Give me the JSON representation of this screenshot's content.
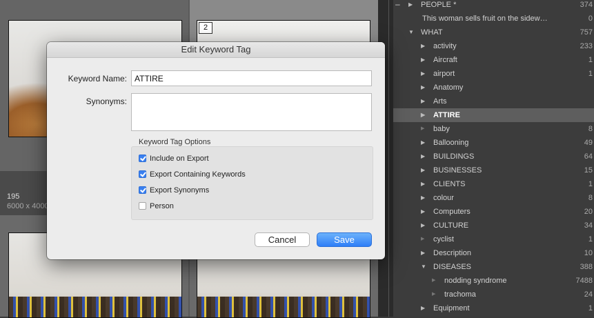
{
  "grid": {
    "badge_number": "2",
    "info_number": "195",
    "info_dimensions": "6000 x 4000"
  },
  "keyword_list": [
    {
      "label": "PEOPLE *",
      "count": "374",
      "level": 0,
      "expander": "right",
      "collapse_dash": true
    },
    {
      "label": "This woman sells fruit on the sidew…",
      "count": "0",
      "level": 0,
      "expander": "none"
    },
    {
      "label": "WHAT",
      "count": "757",
      "level": 0,
      "expander": "down"
    },
    {
      "label": "activity",
      "count": "233",
      "level": 1,
      "expander": "right"
    },
    {
      "label": "Aircraft",
      "count": "1",
      "level": 1,
      "expander": "right"
    },
    {
      "label": "airport",
      "count": "1",
      "level": 1,
      "expander": "right"
    },
    {
      "label": "Anatomy",
      "count": "",
      "level": 1,
      "expander": "right"
    },
    {
      "label": "Arts",
      "count": "",
      "level": 1,
      "expander": "right"
    },
    {
      "label": "ATTIRE",
      "count": "",
      "level": 1,
      "expander": "right",
      "selected": true
    },
    {
      "label": "baby",
      "count": "8",
      "level": 1,
      "expander": "leaf"
    },
    {
      "label": "Ballooning",
      "count": "49",
      "level": 1,
      "expander": "right"
    },
    {
      "label": "BUILDINGS",
      "count": "64",
      "level": 1,
      "expander": "right"
    },
    {
      "label": "BUSINESSES",
      "count": "15",
      "level": 1,
      "expander": "right"
    },
    {
      "label": "CLIENTS",
      "count": "1",
      "level": 1,
      "expander": "right"
    },
    {
      "label": "colour",
      "count": "8",
      "level": 1,
      "expander": "right"
    },
    {
      "label": "Computers",
      "count": "20",
      "level": 1,
      "expander": "right"
    },
    {
      "label": "CULTURE",
      "count": "34",
      "level": 1,
      "expander": "right"
    },
    {
      "label": "cyclist",
      "count": "1",
      "level": 1,
      "expander": "leaf"
    },
    {
      "label": "Description",
      "count": "10",
      "level": 1,
      "expander": "right"
    },
    {
      "label": "DISEASES",
      "count": "388",
      "level": 1,
      "expander": "down"
    },
    {
      "label": "nodding syndrome",
      "count": "7488",
      "level": 2,
      "expander": "leaf"
    },
    {
      "label": "trachoma",
      "count": "24",
      "level": 2,
      "expander": "leaf"
    },
    {
      "label": "Equipment",
      "count": "1",
      "level": 1,
      "expander": "right"
    }
  ],
  "dialog": {
    "title": "Edit Keyword Tag",
    "keyword_name_label": "Keyword Name:",
    "keyword_name_value": "ATTIRE",
    "synonyms_label": "Synonyms:",
    "synonyms_value": "",
    "options_title": "Keyword Tag Options",
    "options": [
      {
        "label": "Include on Export",
        "checked": true
      },
      {
        "label": "Export Containing Keywords",
        "checked": true
      },
      {
        "label": "Export Synonyms",
        "checked": true
      },
      {
        "label": "Person",
        "checked": false
      }
    ],
    "cancel_label": "Cancel",
    "save_label": "Save"
  },
  "colors": {
    "accent": "#3a80f0",
    "selected_row": "#5e5e5e",
    "panel_bg": "#3c3c3c"
  }
}
